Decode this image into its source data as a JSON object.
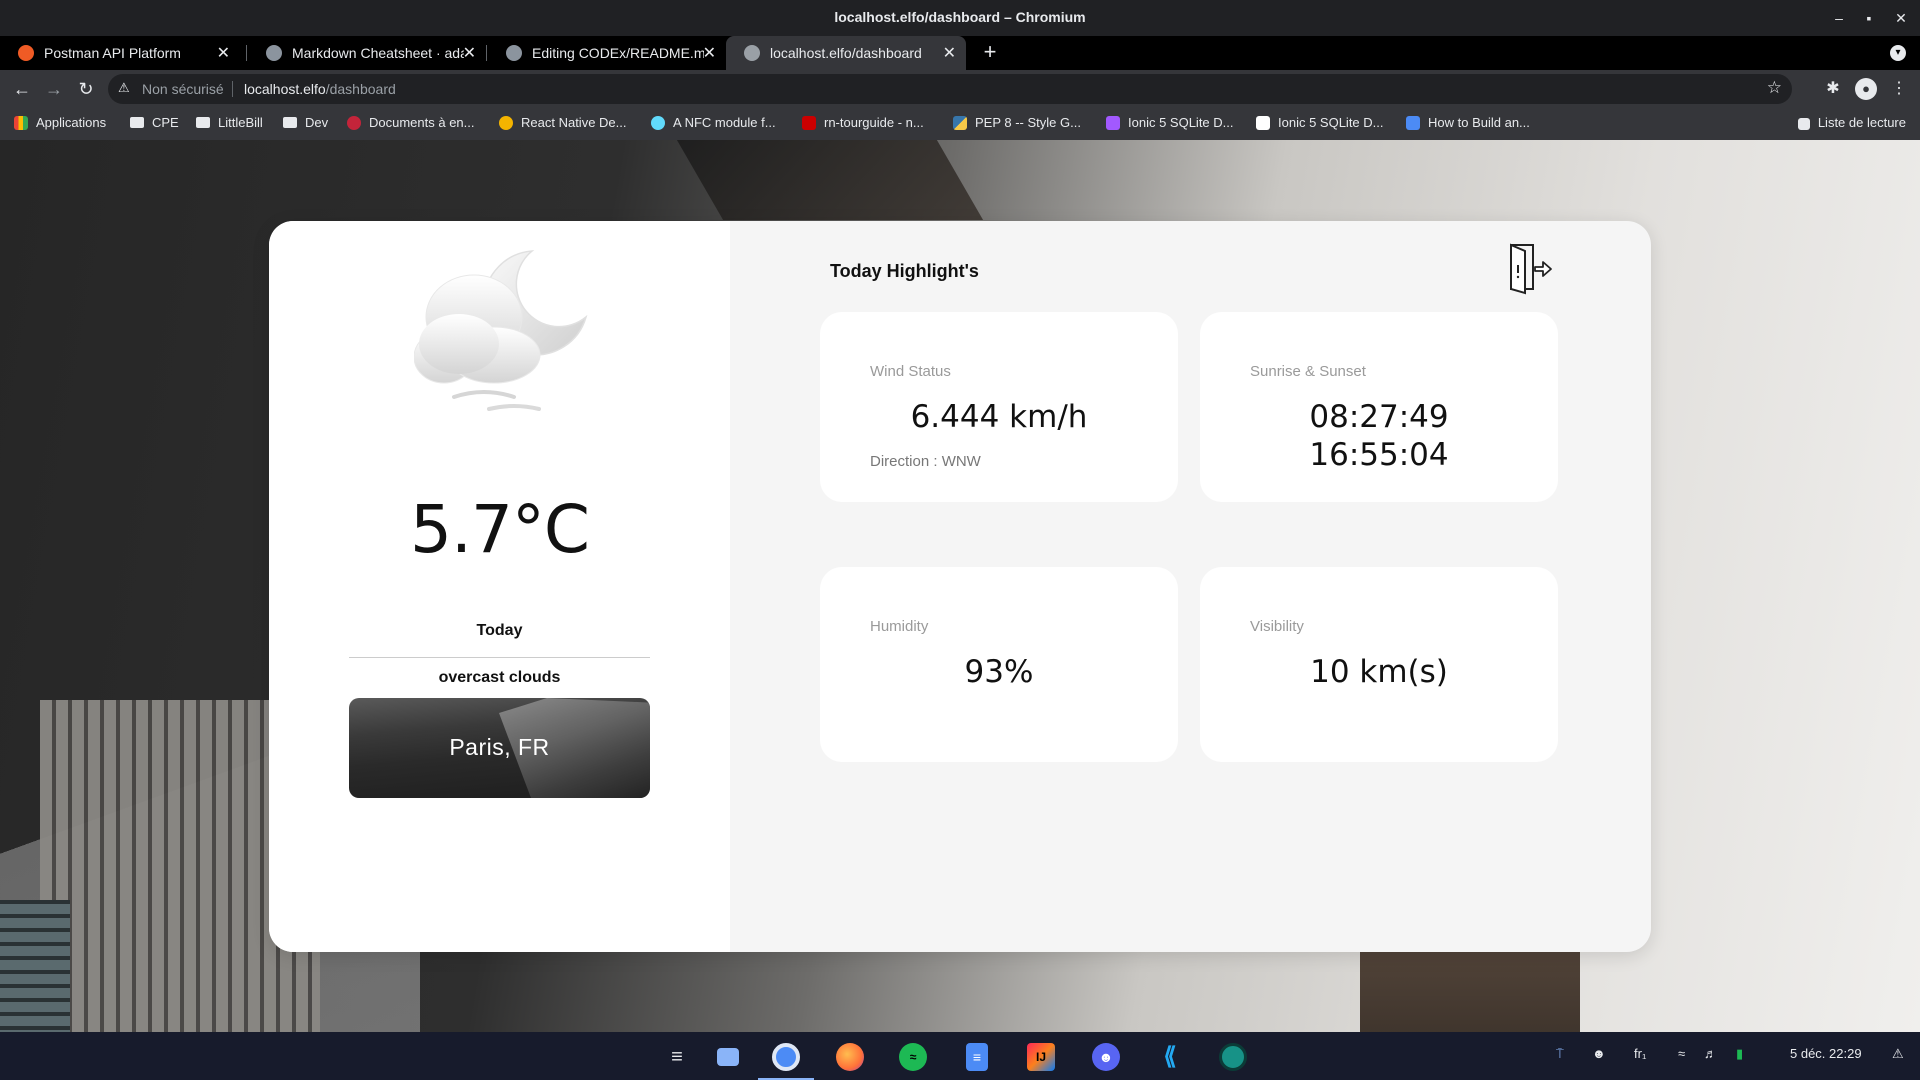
{
  "window": {
    "title": "localhost.elfo/dashboard – Chromium"
  },
  "tabs": [
    {
      "label": "Postman API Platform",
      "color": "#ef5b25"
    },
    {
      "label": "Markdown Cheatsheet · adam-p/markdown-here",
      "color": "#8b949e"
    },
    {
      "label": "Editing CODEx/README.md",
      "color": "#8b949e"
    },
    {
      "label": "localhost.elfo/dashboard",
      "color": "#e8eaed"
    }
  ],
  "omnibox": {
    "security": "Non sécurisé",
    "host": "localhost.elfo",
    "path": "/dashboard"
  },
  "bookmarks": [
    {
      "label": "Applications",
      "color": "#e8eaed"
    },
    {
      "label": "CPE",
      "color": "#e8eaed"
    },
    {
      "label": "LittleBill",
      "color": "#e8eaed"
    },
    {
      "label": "Dev",
      "color": "#e8eaed"
    },
    {
      "label": "Documents à en...",
      "color": "#c4243a"
    },
    {
      "label": "React Native De...",
      "color": "#f4b400"
    },
    {
      "label": "A NFC module f...",
      "color": "#61dafb"
    },
    {
      "label": "rn-tourguide - n...",
      "color": "#cb0000"
    },
    {
      "label": "PEP 8 -- Style G...",
      "color": "#f7c948"
    },
    {
      "label": "Ionic 5 SQLite D...",
      "color": "#a259ff"
    },
    {
      "label": "Ionic 5 SQLite D...",
      "color": "#ffffff"
    },
    {
      "label": "How to Build an...",
      "color": "#4c8bf5"
    }
  ],
  "reading_list": "Liste de lecture",
  "weather": {
    "temperature": "5.7°C",
    "day": "Today",
    "description": "overcast clouds",
    "city": "Paris, FR",
    "icon": "cloud-moon-icon"
  },
  "highlights": {
    "title": "Today Highlight's",
    "wind": {
      "label": "Wind Status",
      "value": "6.444 km/h",
      "direction": "Direction : WNW"
    },
    "sun": {
      "label": "Sunrise & Sunset",
      "sunrise": "08:27:49",
      "sunset": "16:55:04"
    },
    "humidity": {
      "label": "Humidity",
      "value": "93%"
    },
    "visibility": {
      "label": "Visibility",
      "value": "10 km(s)"
    }
  },
  "taskbar": {
    "apps": [
      {
        "name": "zorin-menu-icon",
        "color": "#e8eaed"
      },
      {
        "name": "files-icon",
        "color": "#8ab4f8"
      },
      {
        "name": "chromium-icon",
        "color": "#4c8bf5"
      },
      {
        "name": "firefox-icon",
        "color": "#ff7139"
      },
      {
        "name": "spotify-icon",
        "color": "#1db954"
      },
      {
        "name": "text-editor-icon",
        "color": "#4c8bf5"
      },
      {
        "name": "intellij-icon",
        "color": "#fe2857"
      },
      {
        "name": "discord-icon",
        "color": "#5865f2"
      },
      {
        "name": "vscode-icon",
        "color": "#23a9f2"
      },
      {
        "name": "gitkraken-icon",
        "color": "#179287"
      }
    ],
    "keyboard": "fr₁",
    "datetime": "5 déc.  22:29"
  }
}
